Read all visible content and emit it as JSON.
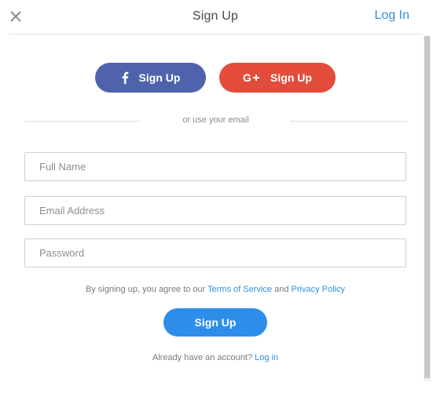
{
  "header": {
    "title": "Sign Up",
    "login_link": "Log In"
  },
  "social": {
    "facebook_label": "Sign Up",
    "google_label": "Sign Up",
    "facebook_icon": "facebook-icon",
    "google_icon": "google-plus-icon",
    "facebook_color": "#4e63ac",
    "google_color": "#e34c3a"
  },
  "divider": {
    "text": "or use your email"
  },
  "form": {
    "full_name_placeholder": "Full Name",
    "full_name_value": "",
    "email_placeholder": "Email Address",
    "email_value": "",
    "password_placeholder": "Password",
    "password_value": ""
  },
  "terms": {
    "prefix": "By signing up, you agree to our ",
    "terms_link": "Terms of Service",
    "and": " and ",
    "privacy_link": "Privacy Policy"
  },
  "submit": {
    "label": "Sign Up",
    "color": "#2d8ee9"
  },
  "footer": {
    "prompt": "Already have an account? ",
    "login_link": "Log in"
  },
  "colors": {
    "accent": "#2e8fe0",
    "text": "#4a4a4a"
  }
}
